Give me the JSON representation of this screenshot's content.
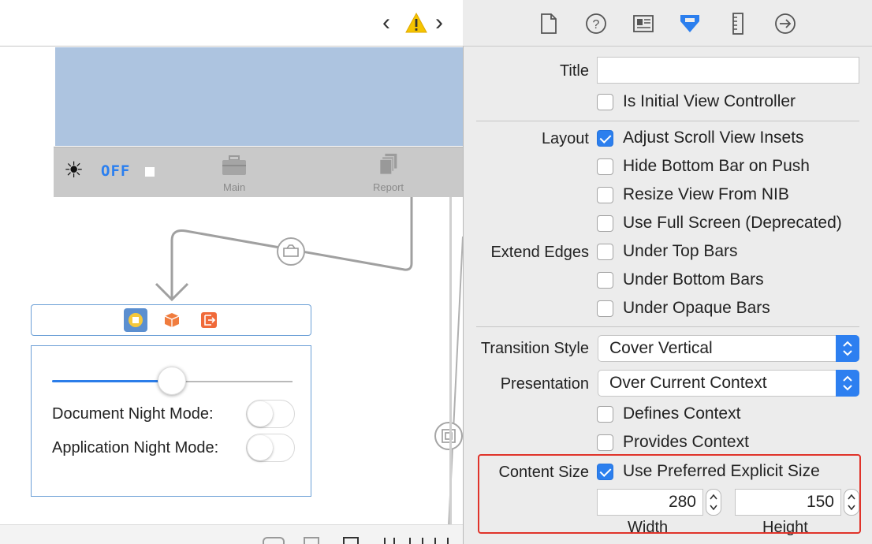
{
  "canvas": {
    "nav": {
      "back": "‹",
      "forward": "›",
      "warning_icon": "warning-icon"
    },
    "tabbar": {
      "off_label": "OFF",
      "items": [
        {
          "label": "Main",
          "icon": "briefcase-icon"
        },
        {
          "label": "Report",
          "icon": "documents-icon"
        }
      ]
    },
    "night_mode": {
      "slider_fraction": 0.5,
      "document_label": "Document Night Mode:",
      "application_label": "Application Night Mode:"
    }
  },
  "inspector": {
    "tabs": [
      "file-icon",
      "help-icon",
      "identity-icon",
      "attributes-icon",
      "size-icon",
      "connections-icon"
    ],
    "active_tab": "attributes-icon",
    "title_label": "Title",
    "title_value": "",
    "is_initial_label": "Is Initial View Controller",
    "layout_label": "Layout",
    "layout_options": [
      {
        "label": "Adjust Scroll View Insets",
        "checked": true
      },
      {
        "label": "Hide Bottom Bar on Push",
        "checked": false
      },
      {
        "label": "Resize View From NIB",
        "checked": false
      },
      {
        "label": "Use Full Screen (Deprecated)",
        "checked": false
      }
    ],
    "extend_edges_label": "Extend Edges",
    "extend_edges_options": [
      {
        "label": "Under Top Bars",
        "checked": false
      },
      {
        "label": "Under Bottom Bars",
        "checked": false
      },
      {
        "label": "Under Opaque Bars",
        "checked": false
      }
    ],
    "transition_style_label": "Transition Style",
    "transition_style_value": "Cover Vertical",
    "presentation_label": "Presentation",
    "presentation_value": "Over Current Context",
    "defines_context_label": "Defines Context",
    "provides_context_label": "Provides Context",
    "content_size_label": "Content Size",
    "use_preferred_label": "Use Preferred Explicit Size",
    "use_preferred_checked": true,
    "width_value": "280",
    "height_value": "150",
    "width_label": "Width",
    "height_label": "Height"
  },
  "colors": {
    "accent": "#2c7fee",
    "highlight": "#e0332a",
    "scene_blue": "#adc4e0",
    "warning": "#f5c400"
  }
}
